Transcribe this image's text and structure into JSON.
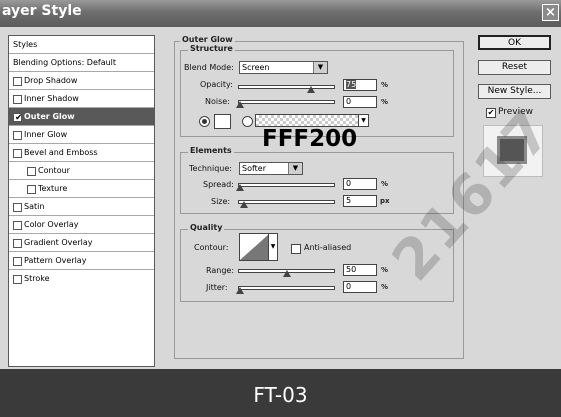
{
  "window": {
    "title": "ayer Style",
    "close": "×"
  },
  "style_list": {
    "header": "Styles",
    "blending": "Blending Options: Default",
    "items": [
      {
        "label": "Drop Shadow",
        "checked": false
      },
      {
        "label": "Inner Shadow",
        "checked": false
      },
      {
        "label": "Outer Glow",
        "checked": true,
        "selected": true
      },
      {
        "label": "Inner Glow",
        "checked": false
      },
      {
        "label": "Bevel and Emboss",
        "checked": false
      },
      {
        "label": "Contour",
        "checked": false
      },
      {
        "label": "Texture",
        "checked": false
      },
      {
        "label": "Satin",
        "checked": false
      },
      {
        "label": "Color Overlay",
        "checked": false
      },
      {
        "label": "Gradient Overlay",
        "checked": false
      },
      {
        "label": "Pattern Overlay",
        "checked": false
      },
      {
        "label": "Stroke",
        "checked": false
      }
    ]
  },
  "panel": {
    "title": "Outer Glow",
    "structure": {
      "title": "Structure",
      "blend_mode_label": "Blend Mode:",
      "blend_mode_value": "Screen",
      "opacity_label": "Opacity:",
      "opacity_value": "75",
      "noise_label": "Noise:",
      "noise_value": "0",
      "percent": "%"
    },
    "elements": {
      "title": "Elements",
      "technique_label": "Technique:",
      "technique_value": "Softer",
      "spread_label": "Spread:",
      "spread_value": "0",
      "size_label": "Size:",
      "size_value": "5",
      "percent": "%",
      "px": "px"
    },
    "quality": {
      "title": "Quality",
      "contour_label": "Contour:",
      "anti_aliased_label": "Anti-aliased",
      "range_label": "Range:",
      "range_value": "50",
      "jitter_label": "Jitter:",
      "jitter_value": "0",
      "percent": "%"
    }
  },
  "buttons": {
    "ok": "OK",
    "reset": "Reset",
    "new_style": "New Style...",
    "preview": "Preview",
    "preview_checked": true
  },
  "overlay_text": "FFF200",
  "footer_text": "FT-03",
  "watermark": "21617",
  "colors": {
    "glow_swatch": "#ffffff",
    "selected_row": "#595959"
  },
  "slider_levels": {
    "opacity": 0.75,
    "noise": 0.0,
    "spread": 0.0,
    "size": 0.05,
    "range": 0.5,
    "jitter": 0.0
  }
}
